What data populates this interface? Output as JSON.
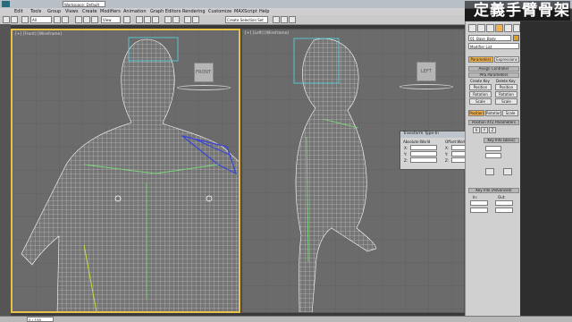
{
  "app": {
    "workspace": "Workspace: Default",
    "overlay_title": "定義手臂骨架"
  },
  "menu": {
    "items": [
      "Edit",
      "Tools",
      "Group",
      "Views",
      "Create",
      "Modifiers",
      "Animation",
      "Graph Editors",
      "Rendering",
      "Customize",
      "MAXScript",
      "Help"
    ]
  },
  "toolbar": {
    "view_dropdown": "View",
    "selection_set": "Create Selection Set"
  },
  "viewports": {
    "front_label": "[+] [Front] [Wireframe]",
    "left_label": "[+] [Left] [Wireframe]",
    "front_cube": "FRONT",
    "left_cube": "LEFT"
  },
  "command_panel": {
    "object_name": "01_Base_Body",
    "modifier_list": "Modifier List",
    "tab_parameters": "Parameters",
    "tab_expressions": "Expressions",
    "assign_controller": "Assign Controller",
    "prs_parameters": "PRS Parameters",
    "create_key": "Create Key",
    "delete_key": "Delete Key",
    "btn_position": "Position",
    "btn_rotation": "Rotation",
    "btn_scale": "Scale",
    "sub_position": "Position",
    "sub_rotation": "Rotation",
    "sub_scale": "Scale",
    "xyz_params": "Position XYZ Parameters",
    "key_info": "Key Info (Basic)",
    "key_info_adv": "Key Info (Advanced)",
    "in_label": "In:",
    "out_label": "Out:"
  },
  "transform_dialog": {
    "title": "Transform Type-In",
    "absolute_label": "Absolute:World",
    "offset_label": "Offset:World",
    "axes": [
      "X:",
      "Y:",
      "Z:"
    ]
  },
  "status": {
    "coord": "0 / 100"
  }
}
